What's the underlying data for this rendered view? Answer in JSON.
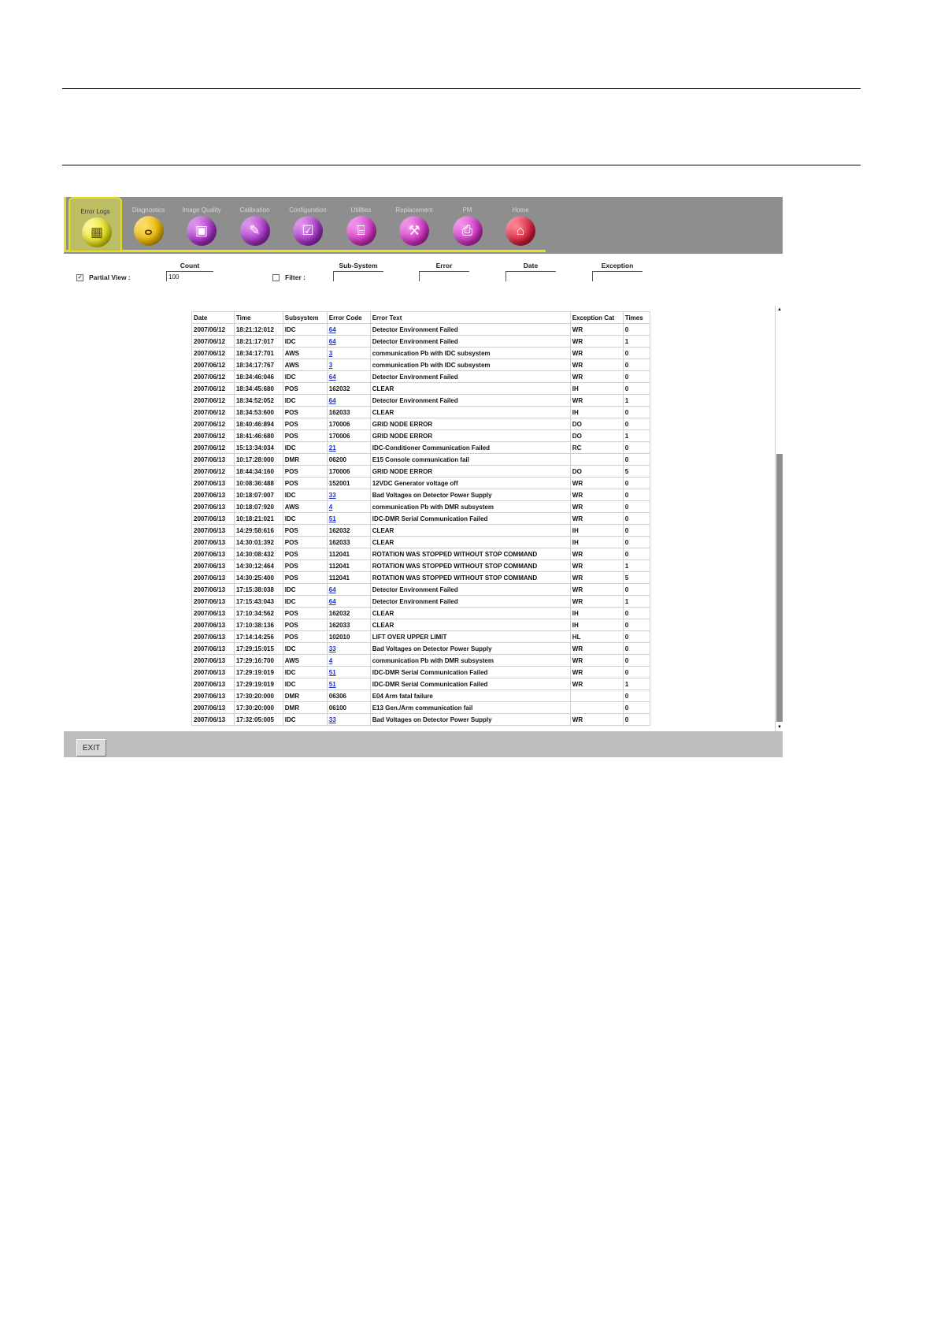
{
  "toolbar": {
    "tabs": [
      {
        "label": "Error Logs",
        "icon": "grid-icon",
        "glyph": "▦",
        "color": "yellow"
      },
      {
        "label": "Diagnostics",
        "icon": "stethoscope-icon",
        "glyph": "ⴰ",
        "color": "orange"
      },
      {
        "label": "Image Quality",
        "icon": "monitor-icon",
        "glyph": "▣",
        "color": "purple"
      },
      {
        "label": "Calibration",
        "icon": "calibration-icon",
        "glyph": "✎",
        "color": "purple"
      },
      {
        "label": "Configuration",
        "icon": "checklist-icon",
        "glyph": "☑",
        "color": "purple"
      },
      {
        "label": "Utilities",
        "icon": "toolbox-icon",
        "glyph": "⌸",
        "color": "magenta"
      },
      {
        "label": "Replacement",
        "icon": "wrench-icon",
        "glyph": "⚒",
        "color": "magenta"
      },
      {
        "label": "PM",
        "icon": "clipboard-icon",
        "glyph": "⎙",
        "color": "magenta"
      },
      {
        "label": "Home",
        "icon": "home-icon",
        "glyph": "⌂",
        "color": "red"
      }
    ]
  },
  "filters": {
    "partial_view_label": "Partial View :",
    "partial_view_checked": "✓",
    "count_label": "Count",
    "count_value": "100",
    "filter_label": "Filter :",
    "subsystem_label": "Sub-System",
    "error_label": "Error",
    "date_label": "Date",
    "exception_label": "Exception"
  },
  "table": {
    "headers": [
      "Date",
      "Time",
      "Subsystem",
      "Error Code",
      "Error Text",
      "Exception Cat",
      "Times"
    ],
    "rows": [
      [
        "2007/06/12",
        "18:21:12:012",
        "IDC",
        "64",
        "Detector Environment Failed",
        "WR",
        "0"
      ],
      [
        "2007/06/12",
        "18:21:17:017",
        "IDC",
        "64",
        "Detector Environment Failed",
        "WR",
        "1"
      ],
      [
        "2007/06/12",
        "18:34:17:701",
        "AWS",
        "3",
        "communication Pb with IDC subsystem",
        "WR",
        "0"
      ],
      [
        "2007/06/12",
        "18:34:17:767",
        "AWS",
        "3",
        "communication Pb with IDC subsystem",
        "WR",
        "0"
      ],
      [
        "2007/06/12",
        "18:34:46:046",
        "IDC",
        "64",
        "Detector Environment Failed",
        "WR",
        "0"
      ],
      [
        "2007/06/12",
        "18:34:45:680",
        "POS",
        "162032",
        "CLEAR",
        "IH",
        "0"
      ],
      [
        "2007/06/12",
        "18:34:52:052",
        "IDC",
        "64",
        "Detector Environment Failed",
        "WR",
        "1"
      ],
      [
        "2007/06/12",
        "18:34:53:600",
        "POS",
        "162033",
        "CLEAR",
        "IH",
        "0"
      ],
      [
        "2007/06/12",
        "18:40:46:894",
        "POS",
        "170006",
        "GRID NODE ERROR",
        "DO",
        "0"
      ],
      [
        "2007/06/12",
        "18:41:46:680",
        "POS",
        "170006",
        "GRID NODE ERROR",
        "DO",
        "1"
      ],
      [
        "2007/06/12",
        "15:13:34:034",
        "IDC",
        "21",
        "IDC-Conditioner Communication Failed",
        "RC",
        "0"
      ],
      [
        "2007/06/13",
        "10:17:28:000",
        "DMR",
        "06200",
        "E15 Console communication fail",
        "",
        "0"
      ],
      [
        "2007/06/12",
        "18:44:34:160",
        "POS",
        "170006",
        "GRID NODE ERROR",
        "DO",
        "5"
      ],
      [
        "2007/06/13",
        "10:08:36:488",
        "POS",
        "152001",
        "12VDC Generator voltage off",
        "WR",
        "0"
      ],
      [
        "2007/06/13",
        "10:18:07:007",
        "IDC",
        "33",
        "Bad Voltages on Detector Power Supply",
        "WR",
        "0"
      ],
      [
        "2007/06/13",
        "10:18:07:920",
        "AWS",
        "4",
        "communication Pb with DMR subsystem",
        "WR",
        "0"
      ],
      [
        "2007/06/13",
        "10:18:21:021",
        "IDC",
        "51",
        "IDC-DMR Serial Communication Failed",
        "WR",
        "0"
      ],
      [
        "2007/06/13",
        "14:29:58:616",
        "POS",
        "162032",
        "CLEAR",
        "IH",
        "0"
      ],
      [
        "2007/06/13",
        "14:30:01:392",
        "POS",
        "162033",
        "CLEAR",
        "IH",
        "0"
      ],
      [
        "2007/06/13",
        "14:30:08:432",
        "POS",
        "112041",
        "ROTATION WAS STOPPED WITHOUT STOP COMMAND",
        "WR",
        "0"
      ],
      [
        "2007/06/13",
        "14:30:12:464",
        "POS",
        "112041",
        "ROTATION WAS STOPPED WITHOUT STOP COMMAND",
        "WR",
        "1"
      ],
      [
        "2007/06/13",
        "14:30:25:400",
        "POS",
        "112041",
        "ROTATION WAS STOPPED WITHOUT STOP COMMAND",
        "WR",
        "5"
      ],
      [
        "2007/06/13",
        "17:15:38:038",
        "IDC",
        "64",
        "Detector Environment Failed",
        "WR",
        "0"
      ],
      [
        "2007/06/13",
        "17:15:43:043",
        "IDC",
        "64",
        "Detector Environment Failed",
        "WR",
        "1"
      ],
      [
        "2007/06/13",
        "17:10:34:562",
        "POS",
        "162032",
        "CLEAR",
        "IH",
        "0"
      ],
      [
        "2007/06/13",
        "17:10:38:136",
        "POS",
        "162033",
        "CLEAR",
        "IH",
        "0"
      ],
      [
        "2007/06/13",
        "17:14:14:256",
        "POS",
        "102010",
        "LIFT OVER UPPER LIMIT",
        "HL",
        "0"
      ],
      [
        "2007/06/13",
        "17:29:15:015",
        "IDC",
        "33",
        "Bad Voltages on Detector Power Supply",
        "WR",
        "0"
      ],
      [
        "2007/06/13",
        "17:29:16:700",
        "AWS",
        "4",
        "communication Pb with DMR subsystem",
        "WR",
        "0"
      ],
      [
        "2007/06/13",
        "17:29:19:019",
        "IDC",
        "51",
        "IDC-DMR Serial Communication Failed",
        "WR",
        "0"
      ],
      [
        "2007/06/13",
        "17:29:19:019",
        "IDC",
        "51",
        "IDC-DMR Serial Communication Failed",
        "WR",
        "1"
      ],
      [
        "2007/06/13",
        "17:30:20:000",
        "DMR",
        "06306",
        "E04 Arm fatal failure",
        "",
        "0"
      ],
      [
        "2007/06/13",
        "17:30:20:000",
        "DMR",
        "06100",
        "E13 Gen./Arm communication fail",
        "",
        "0"
      ],
      [
        "2007/06/13",
        "17:32:05:005",
        "IDC",
        "33",
        "Bad Voltages on Detector Power Supply",
        "WR",
        "0"
      ]
    ]
  },
  "bottom": {
    "exit_label": "EXIT"
  }
}
